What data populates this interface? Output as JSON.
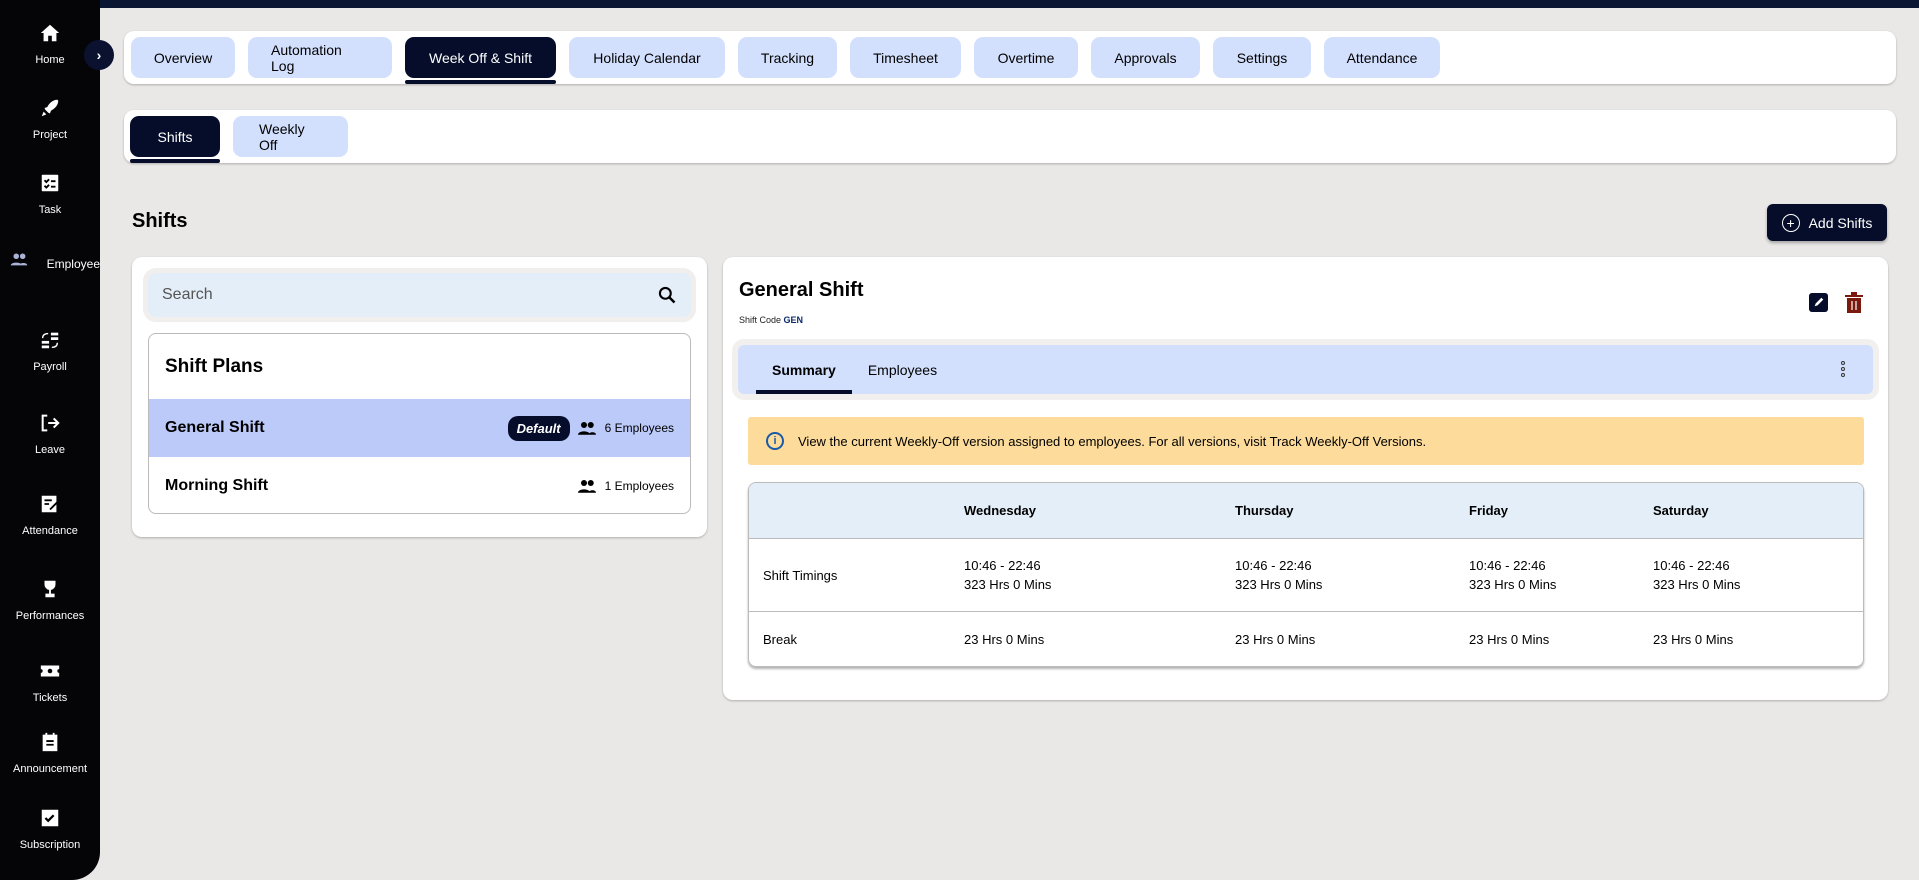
{
  "sidebar": {
    "items": [
      {
        "label": "Home",
        "icon": "home-icon"
      },
      {
        "label": "Project",
        "icon": "rocket-icon"
      },
      {
        "label": "Task",
        "icon": "task-list-icon"
      },
      {
        "label": "Employee",
        "icon": "people-icon"
      },
      {
        "label": "Payroll",
        "icon": "payroll-icon"
      },
      {
        "label": "Leave",
        "icon": "logout-icon"
      },
      {
        "label": "Attendance",
        "icon": "edit-note-icon"
      },
      {
        "label": "Performances",
        "icon": "trophy-icon"
      },
      {
        "label": "Tickets",
        "icon": "ticket-icon"
      },
      {
        "label": "Announcement",
        "icon": "clipboard-icon"
      },
      {
        "label": "Subscription",
        "icon": "checkbox-icon"
      }
    ]
  },
  "top_tabs": [
    "Overview",
    "Automation Log",
    "Week Off & Shift",
    "Holiday Calendar",
    "Tracking",
    "Timesheet",
    "Overtime",
    "Approvals",
    "Settings",
    "Attendance"
  ],
  "sub_tabs": [
    "Shifts",
    "Weekly Off"
  ],
  "page": {
    "title": "Shifts",
    "add_button": "Add Shifts"
  },
  "search": {
    "placeholder": "Search"
  },
  "plans": {
    "title": "Shift Plans",
    "items": [
      {
        "name": "General Shift",
        "badge": "Default",
        "employees": "6 Employees"
      },
      {
        "name": "Morning Shift",
        "employees": "1 Employees"
      }
    ]
  },
  "detail": {
    "title": "General Shift",
    "code_label": "Shift Code",
    "code": "GEN",
    "tabs": [
      "Summary",
      "Employees"
    ],
    "alert": "View the current Weekly-Off version assigned to employees. For all versions, visit Track Weekly-Off Versions.",
    "table": {
      "columns": [
        "",
        "Wednesday",
        "Thursday",
        "Friday",
        "Saturday"
      ],
      "rows": [
        {
          "label": "Shift Timings",
          "cells": [
            [
              "10:46 - 22:46",
              "323 Hrs 0 Mins"
            ],
            [
              "10:46 - 22:46",
              "323 Hrs 0 Mins"
            ],
            [
              "10:46 - 22:46",
              "323 Hrs 0 Mins"
            ],
            [
              "10:46 - 22:46",
              "323 Hrs 0 Mins"
            ]
          ]
        },
        {
          "label": "Break",
          "cells": [
            "23 Hrs 0 Mins",
            "23 Hrs 0 Mins",
            "23 Hrs 0 Mins",
            "23 Hrs 0 Mins"
          ]
        }
      ]
    }
  },
  "colors": {
    "primary": "#050d2a",
    "tab_bg": "#d3e0fd",
    "selected_row": "#bccafa",
    "alert_bg": "#fddc9b",
    "delete": "#7a1a0e"
  }
}
